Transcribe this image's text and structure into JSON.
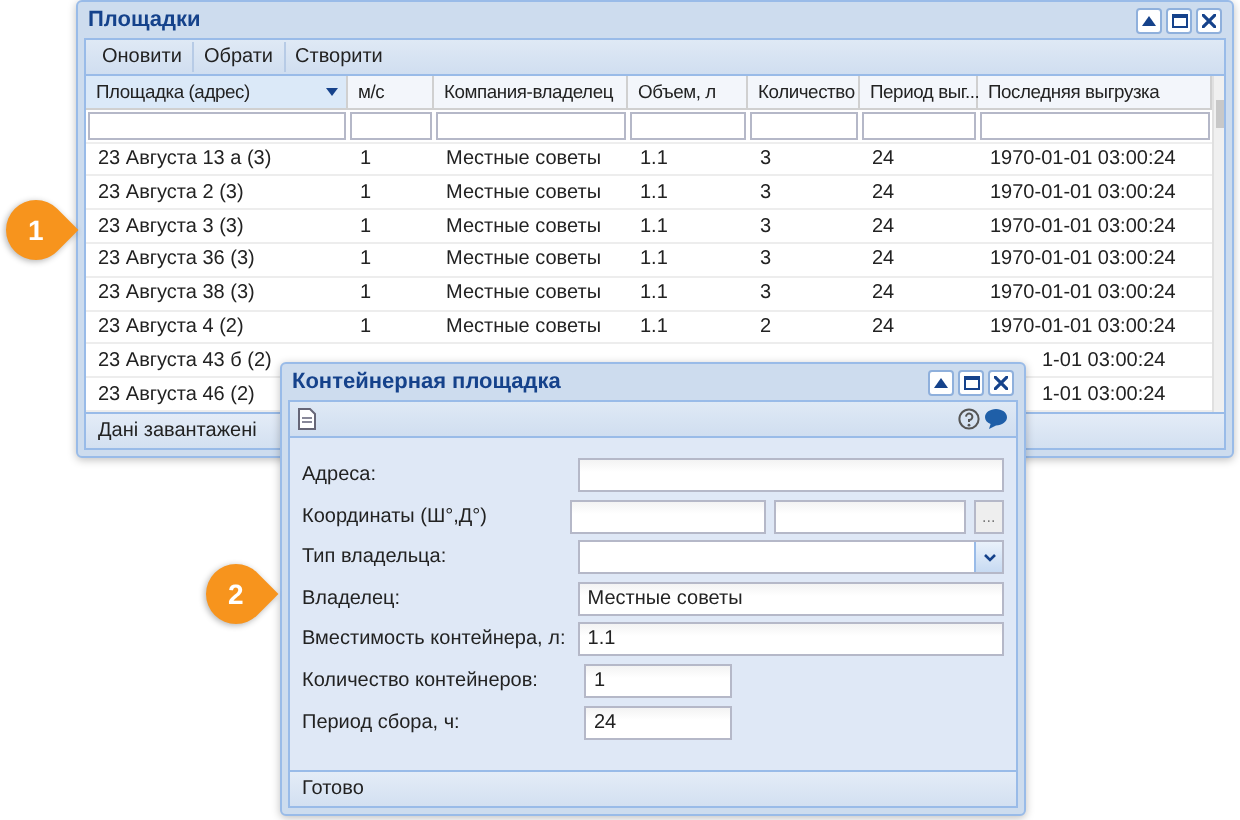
{
  "main_window": {
    "title": "Площадки",
    "toolbar": [
      "Оновити",
      "Обрати",
      "Створити"
    ],
    "columns": [
      {
        "label": "Площадка (адрес)",
        "active": true
      },
      {
        "label": "м/с",
        "active": false
      },
      {
        "label": "Компания-владелец",
        "active": false
      },
      {
        "label": "Объем, л",
        "active": false
      },
      {
        "label": "Количество",
        "active": false
      },
      {
        "label": "Период выг...",
        "active": false
      },
      {
        "label": "Последняя выгрузка",
        "active": false
      }
    ],
    "rows": [
      {
        "cells": [
          "23 Августа 13 а (3)",
          "1",
          "Местные советы",
          "1.1",
          "3",
          "24",
          "1970-01-01 03:00:24"
        ]
      },
      {
        "cells": [
          "23 Августа 2 (3)",
          "1",
          "Местные советы",
          "1.1",
          "3",
          "24",
          "1970-01-01 03:00:24"
        ]
      },
      {
        "cells": [
          "23 Августа 3 (3)",
          "1",
          "Местные советы",
          "1.1",
          "3",
          "24",
          "1970-01-01 03:00:24"
        ]
      },
      {
        "cells": [
          "23 Августа 36 (3)",
          "1",
          "Местные советы",
          "1.1",
          "3",
          "24",
          "1970-01-01 03:00:24"
        ]
      },
      {
        "cells": [
          "23 Августа 38 (3)",
          "1",
          "Местные советы",
          "1.1",
          "3",
          "24",
          "1970-01-01 03:00:24"
        ]
      },
      {
        "cells": [
          "23 Августа 4 (2)",
          "1",
          "Местные советы",
          "1.1",
          "2",
          "24",
          "1970-01-01 03:00:24"
        ]
      },
      {
        "cells": [
          "23 Августа 43 б (2)",
          null,
          null,
          null,
          null,
          null,
          "1-01 03:00:24"
        ]
      },
      {
        "cells": [
          "23 Августа 46 (2)",
          null,
          null,
          null,
          null,
          null,
          "1-01 03:00:24"
        ]
      }
    ],
    "status": "Дані завантажені"
  },
  "dialog": {
    "title": "Контейнерная площадка",
    "fields": [
      {
        "label": "Адреса:",
        "kind": "wide"
      },
      {
        "label": "Координаты (Ш°,Д°)",
        "kind": "coords",
        "button": "..."
      },
      {
        "label": "Тип владельца:",
        "kind": "combo"
      },
      {
        "label": "Владелец:",
        "kind": "wide",
        "value": "Местные советы"
      },
      {
        "label": "Вместимость контейнера, л:",
        "kind": "wide",
        "value": "1.1"
      },
      {
        "label": "Количество контейнеров:",
        "kind": "short",
        "value": "1"
      },
      {
        "label": "Период сбора, ч:",
        "kind": "short",
        "value": "24"
      }
    ],
    "status": "Готово"
  },
  "callouts": [
    "1",
    "2"
  ]
}
